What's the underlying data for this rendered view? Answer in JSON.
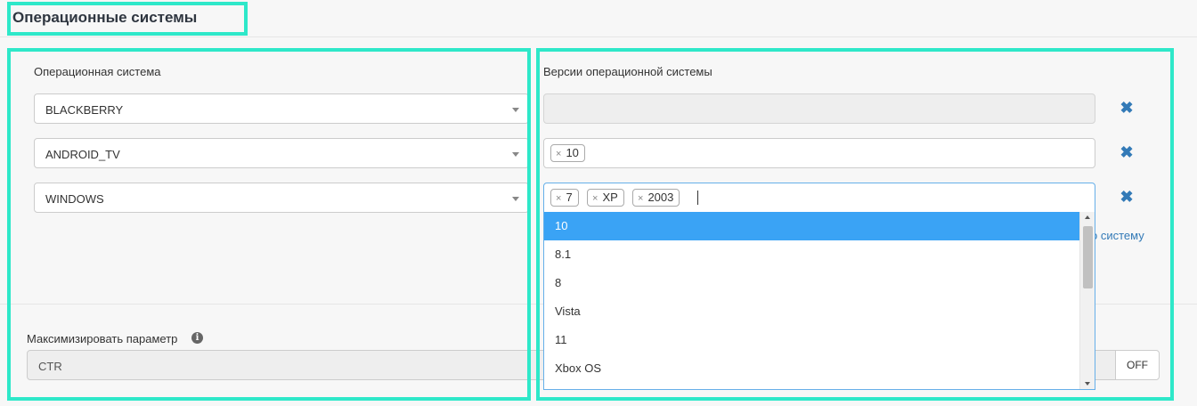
{
  "section": {
    "title": "Операционные системы"
  },
  "labels": {
    "os": "Операционная система",
    "versions": "Версии операционной системы"
  },
  "rows": [
    {
      "os": "BLACKBERRY",
      "versions": []
    },
    {
      "os": "ANDROID_TV",
      "versions": [
        "10"
      ]
    },
    {
      "os": "WINDOWS",
      "versions": [
        "7",
        "XP",
        "2003"
      ]
    }
  ],
  "chip_remove_glyph": "×",
  "remove_row_icon": "close-icon",
  "add_link": "о систему",
  "dropdown": {
    "options": [
      "10",
      "8.1",
      "8",
      "Vista",
      "11",
      "Xbox OS"
    ],
    "highlighted": "10"
  },
  "maximize": {
    "label": "Максимизировать параметр",
    "value": "CTR",
    "toggle": "OFF"
  },
  "colors": {
    "highlight_box": "#2ee8c9",
    "accent_blue": "#3aa3f5",
    "link_blue": "#337ab7"
  }
}
